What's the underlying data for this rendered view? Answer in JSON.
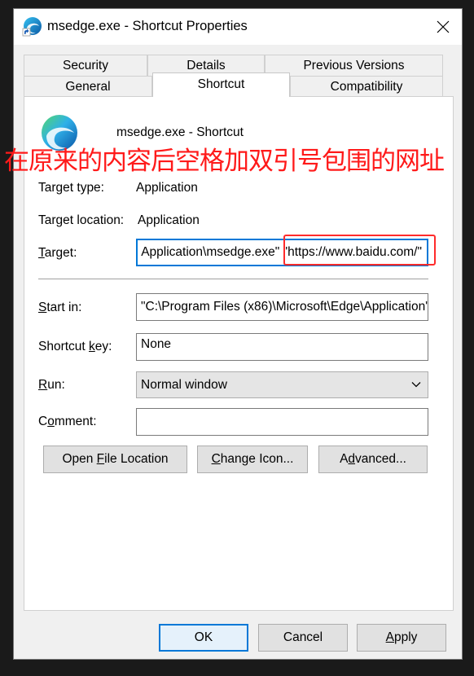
{
  "window": {
    "title": "msedge.exe - Shortcut Properties"
  },
  "tabs": [
    {
      "label": "Security"
    },
    {
      "label": "Details"
    },
    {
      "label": "Previous Versions"
    },
    {
      "label": "General"
    },
    {
      "label": "Shortcut",
      "active": true
    },
    {
      "label": "Compatibility"
    }
  ],
  "header": {
    "name": "msedge.exe - Shortcut"
  },
  "annotation": {
    "text": "在原来的内容后空格加双引号包围的网址",
    "color": "#ff1a1a"
  },
  "fields": {
    "target_type_label": "Target type:",
    "target_type_value": "Application",
    "target_location_label": "Target location:",
    "target_location_value": "Application",
    "target_label_pre": "",
    "target_label_u": "T",
    "target_label_post": "arget:",
    "target_value_path": "Application\\msedge.exe\"",
    "target_value_url": "\"https://www.baidu.com/\"",
    "start_in_label_pre": "",
    "start_in_label_u": "S",
    "start_in_label_post": "tart in:",
    "start_in_value": "\"C:\\Program Files (x86)\\Microsoft\\Edge\\Application\"",
    "shortcut_key_label_pre": "Shortcut ",
    "shortcut_key_label_u": "k",
    "shortcut_key_label_post": "ey:",
    "shortcut_key_value": "None",
    "run_label_pre": "",
    "run_label_u": "R",
    "run_label_post": "un:",
    "run_value": "Normal window",
    "comment_label_pre": "C",
    "comment_label_u": "o",
    "comment_label_post": "mment:",
    "comment_value": ""
  },
  "buttons": {
    "open_file_pre": "Open ",
    "open_file_u": "F",
    "open_file_post": "ile Location",
    "change_icon_pre": "",
    "change_icon_u": "C",
    "change_icon_post": "hange Icon...",
    "advanced_pre": "A",
    "advanced_u": "d",
    "advanced_post": "vanced...",
    "ok": "OK",
    "cancel": "Cancel",
    "apply_pre": "",
    "apply_u": "A",
    "apply_post": "pply"
  },
  "colors": {
    "accent": "#0078d7",
    "annotation_red": "#ff2b2b"
  }
}
